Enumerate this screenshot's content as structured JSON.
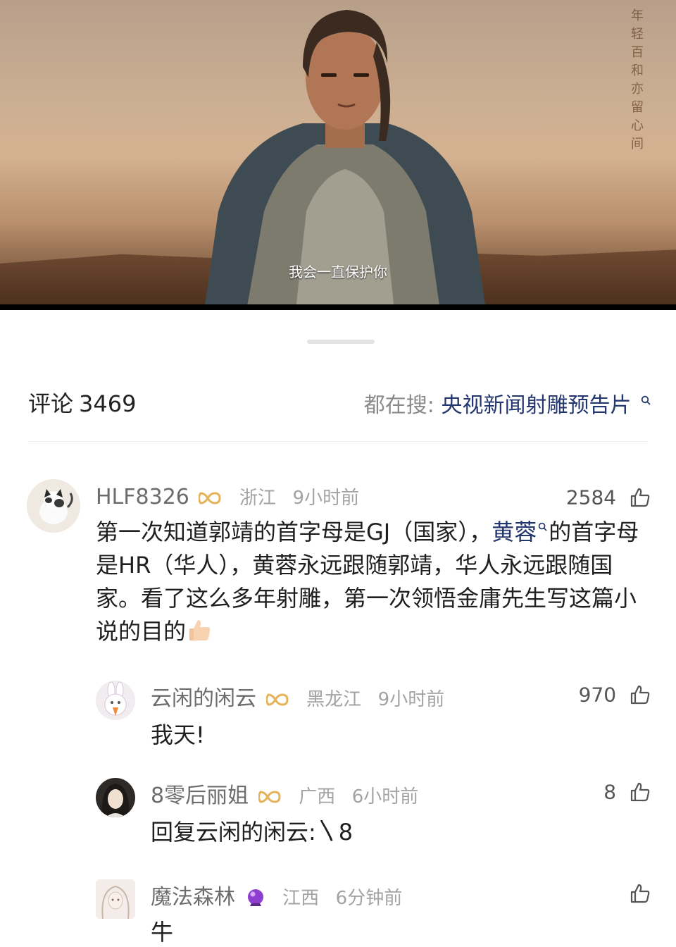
{
  "video": {
    "subtitle": "我会一直保护你",
    "vertical_text": "年轻百和亦留心间"
  },
  "comments_panel": {
    "title": "评论",
    "count": "3469",
    "trending_label": "都在搜:",
    "trending_keyword": "央视新闻射雕预告片"
  },
  "comments": [
    {
      "user": "HLF8326",
      "location": "浙江",
      "time": "9小时前",
      "likes": "2584",
      "text_part1": "第一次知道郭靖的首字母是GJ（国家），",
      "link": "黄蓉",
      "text_part2": "的首字母是HR（华人），黄蓉永远跟随郭靖，华人永远跟随国家。看了这么多年射雕，第一次领悟金庸先生写这篇小说的目的"
    },
    {
      "user": "云闲的闲云",
      "location": "黑龙江",
      "time": "9小时前",
      "likes": "970",
      "text": "我天!"
    },
    {
      "user": "8零后丽姐",
      "location": "广西",
      "time": "6小时前",
      "likes": "8",
      "text": "回复云闲的闲云:〵8"
    },
    {
      "user": "魔法森林",
      "location": "江西",
      "time": "6分钟前",
      "likes": "",
      "text": "牛"
    }
  ],
  "colors": {
    "accent_link": "#24366e",
    "badge_gold": "#e6b35a",
    "muted": "#a3a3a3"
  },
  "icons": [
    "search-icon",
    "thumbs-up-icon",
    "vip-badge-icon",
    "crystal-ball-icon",
    "thumbs-up-emoji"
  ]
}
